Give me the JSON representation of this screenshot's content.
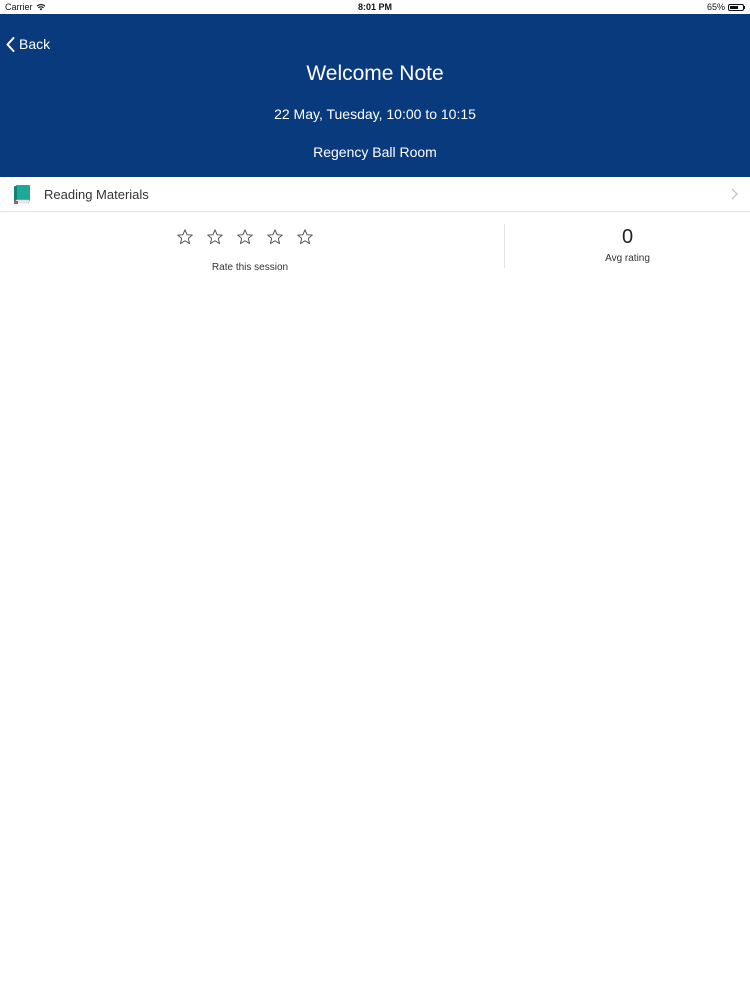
{
  "status_bar": {
    "carrier": "Carrier",
    "time": "8:01 PM",
    "battery": "65%",
    "battery_level": 0.65
  },
  "header": {
    "back_label": "Back",
    "title": "Welcome Note",
    "datetime": "22 May, Tuesday, 10:00 to 10:15",
    "location": "Regency Ball Room",
    "background_color": "#0a3a7e"
  },
  "reading_materials": {
    "label": "Reading Materials",
    "icon": "book-icon",
    "icon_color": "#1fa89a"
  },
  "rating": {
    "rate_label": "Rate this session",
    "user_rating": 0,
    "max_stars": 5,
    "avg_value": "0",
    "avg_label": "Avg rating"
  }
}
